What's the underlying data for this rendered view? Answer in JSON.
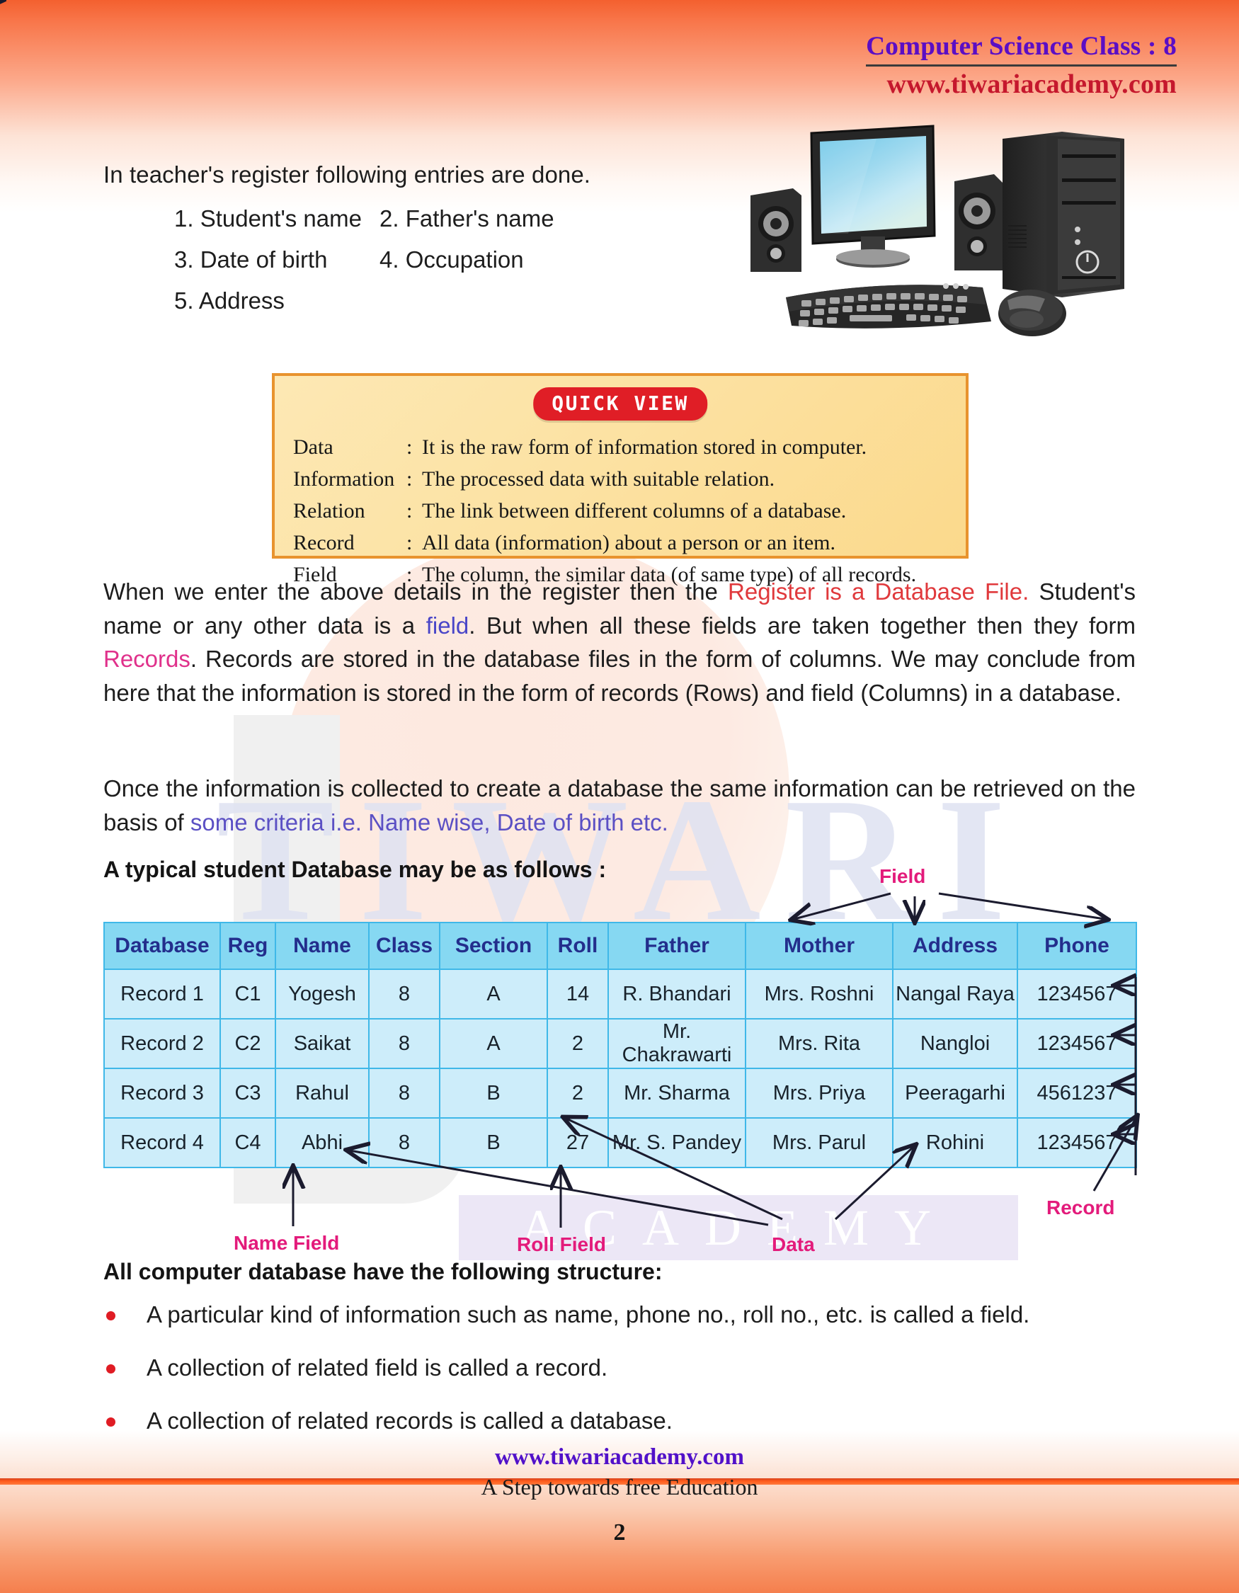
{
  "header": {
    "title": "Computer Science Class : 8",
    "url": "www.tiwariacademy.com"
  },
  "intro": {
    "line": "In teacher's register following entries are done.",
    "entries": [
      "1. Student's name",
      "2. Father's name",
      "3. Date of birth",
      "4. Occupation",
      "5. Address"
    ]
  },
  "quick_view": {
    "badge": "QUICK VIEW",
    "colon": ":",
    "rows": [
      {
        "term": "Data",
        "definition": "It is the raw form of information stored in computer."
      },
      {
        "term": "Information",
        "definition": "The processed data with suitable relation."
      },
      {
        "term": "Relation",
        "definition": "The link between different columns of a database."
      },
      {
        "term": "Record",
        "definition": "All data (information) about a person or an item."
      },
      {
        "term": "Field",
        "definition": "The column, the similar data (of same type) of all records."
      }
    ]
  },
  "paragraph1": {
    "t1": "When we enter the above details in the register then the ",
    "hl1": "Register is a Database File.",
    "t2": " Student's name or any other data is a ",
    "hl2": "field",
    "t3": ". But when all these fields are taken together then they form ",
    "hl3": "Records",
    "t4": ". Records are stored in the database files in the form of columns. We may conclude from here that the information is stored in the form of records (Rows) and field (Columns) in a database."
  },
  "paragraph2": {
    "t1": "Once the information is collected to create a database the same information can be retrieved on the basis of ",
    "hl1": "some criteria i.e. Name wise, Date of birth etc."
  },
  "sub_head": "A typical student Database may be as follows :",
  "chart_data": {
    "type": "table",
    "title": "A typical student Database may be as follows :",
    "columns": [
      "Database",
      "Reg",
      "Name",
      "Class",
      "Section",
      "Roll",
      "Father",
      "Mother",
      "Address",
      "Phone"
    ],
    "rows": [
      [
        "Record 1",
        "C1",
        "Yogesh",
        "8",
        "A",
        "14",
        "R. Bhandari",
        "Mrs. Roshni",
        "Nangal Raya",
        "1234567"
      ],
      [
        "Record 2",
        "C2",
        "Saikat",
        "8",
        "A",
        "2",
        "Mr. Chakrawarti",
        "Mrs. Rita",
        "Nangloi",
        "1234567"
      ],
      [
        "Record 3",
        "C3",
        "Rahul",
        "8",
        "B",
        "2",
        "Mr. Sharma",
        "Mrs. Priya",
        "Peeragarhi",
        "4561237"
      ],
      [
        "Record 4",
        "C4",
        "Abhi",
        "8",
        "B",
        "27",
        "Mr. S. Pandey",
        "Mrs. Parul",
        "Rohini",
        "1234567"
      ]
    ],
    "annotations": [
      {
        "label": "Field",
        "points_to": "column headers (Mother, Address, Phone)"
      },
      {
        "label": "Name Field",
        "points_to": "Name column"
      },
      {
        "label": "Roll Field",
        "points_to": "Roll column"
      },
      {
        "label": "Data",
        "points_to": "individual cell values"
      },
      {
        "label": "Record",
        "points_to": "each table row"
      }
    ],
    "header_bg": "#86d8f2",
    "body_bg": "#cdedfa",
    "border_color": "#3fb8e8",
    "annotation_color": "#e31b7b"
  },
  "structure": {
    "heading": "All computer database have the following structure:",
    "bullets": [
      "A particular kind of information such as name, phone no., roll no., etc. is called a field.",
      "A collection of related field is called a record.",
      "A collection of related records is called a database."
    ]
  },
  "footer": {
    "url": "www.tiwariacademy.com",
    "tagline": "A Step towards free Education",
    "page_number": "2"
  },
  "colors": {
    "brand_purple": "#5b0ec4",
    "brand_red": "#c5182d",
    "accent_orange": "#f4602f",
    "highlight_red": "#e0393c",
    "highlight_blue": "#4a46c8",
    "highlight_pink": "#e0318b",
    "bullet_red": "#e01c24"
  }
}
